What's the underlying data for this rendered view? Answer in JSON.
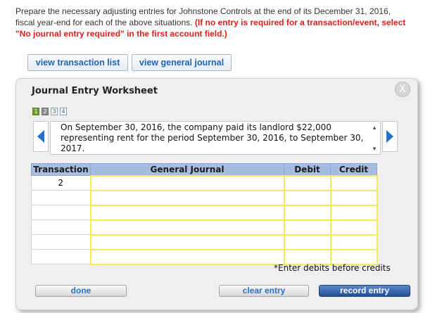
{
  "instructions": {
    "line1": "Prepare the necessary adjusting entries for Johnstone Controls at the end of its December 31, 2016,",
    "line2": "fiscal year-end for each of the above situations.",
    "warning_line2": "(If no entry is required for a transaction/event, select",
    "warning_line3": "\"No journal entry required\" in the first account field.)"
  },
  "top_buttons": {
    "transaction_list": "view transaction list",
    "general_journal": "view general journal"
  },
  "worksheet": {
    "title": "Journal Entry Worksheet",
    "close_glyph": "X",
    "pages": [
      "1",
      "2",
      "3",
      "4"
    ],
    "active_page": "1",
    "description": "On September 30, 2016, the company paid its landlord $22,000 representing rent for the period September 30, 2016, to September 30, 2017.",
    "table": {
      "headers": {
        "transaction": "Transaction",
        "general_journal": "General Journal",
        "debit": "Debit",
        "credit": "Credit"
      },
      "transaction_number": "2",
      "row_count": 6
    },
    "hint": "*Enter debits before credits",
    "buttons": {
      "done": "done",
      "clear": "clear entry",
      "record": "record entry"
    }
  },
  "colors": {
    "warning_red": "#e0201c",
    "link_blue": "#1e63b8",
    "table_header": "#a7bde0",
    "input_border": "#f1ea5e",
    "active_page": "#6e9f2a",
    "record_button": "#234f96"
  }
}
